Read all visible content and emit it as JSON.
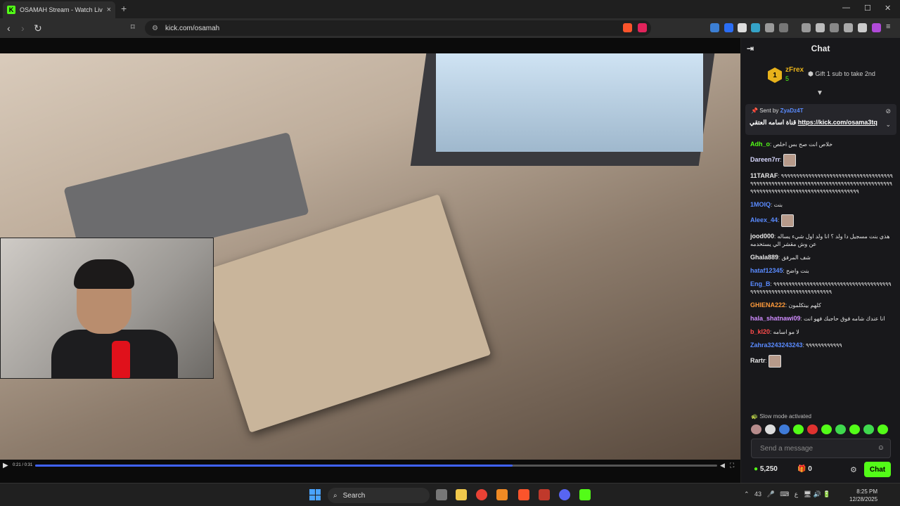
{
  "browser": {
    "tab_title": "OSAMAH Stream - Watch Live",
    "url": "kick.com/osamah",
    "new_tab": "+",
    "close_tab": "×"
  },
  "player": {
    "time": "0:21 / 0:31",
    "progress": 0.7,
    "play_icon": "play-icon"
  },
  "chat": {
    "title": "Chat",
    "leaderboard": {
      "rank": "1",
      "name": "zFrex",
      "count": "5",
      "gift_text": "Gift 1 sub to take 2nd"
    },
    "pinned": {
      "sent_by": "Sent by",
      "sender": "ZyaDz4T",
      "message": "قناة اسامه العتقي",
      "link": "https://kick.com/osama3tq"
    },
    "messages": [
      {
        "user": "Adh_o",
        "color": "#53fc18",
        "text": "خلاص انت صح بس اخلص"
      },
      {
        "user": "Dareen7rr",
        "color": "#d8d8ff",
        "text": "",
        "emote": true
      },
      {
        "user": "11TARAF",
        "color": "#e8e8e8",
        "text": "٩٩٩٩٩٩٩٩٩٩٩٩٩٩٩٩٩٩٩٩٩٩٩٩٩٩٩٩٩٩٩٩٩٩٩٩٩٩٩٩٩٩٩٩٩٩٩٩٩٩٩٩٩٩٩٩٩٩٩٩٩٩٩٩٩٩٩٩٩٩٩٩٩٩٩٩٩٩٩٩٩٩٩٩٩٩٩٩٩٩٩٩٩٩٩٩٩٩٩٩٩٩٩٩٩٩٩٩٩٩٩٩٩٩٩٩٩٩٩٩"
      },
      {
        "user": "1MOIQ",
        "color": "#5a8bff",
        "text": "بنت"
      },
      {
        "user": "Aleex_44",
        "color": "#5a8bff",
        "text": "",
        "emote": true
      },
      {
        "user": "jood000",
        "color": "#e8e8e8",
        "text": "هذي بنت مسجيل دا ولد ؟ انا ولد اول شيء يساله عن وش مقشر الي يستخدمه"
      },
      {
        "user": "Ghala889",
        "color": "#e8e8e8",
        "text": "شف المرفق"
      },
      {
        "user": "hataf12345",
        "color": "#5a8bff",
        "text": "بنت واضح"
      },
      {
        "user": "Eng_B",
        "color": "#5a8bff",
        "text": "٩٩٩٩٩٩٩٩٩٩٩٩٩٩٩٩٩٩٩٩٩٩٩٩٩٩٩٩٩٩٩٩٩٩٩٩٩٩٩٩٩٩٩٩٩٩٩٩٩٩٩٩٩٩٩٩٩٩٩٩٩٩٩٩٩٩"
      },
      {
        "user": "GHIENA222",
        "color": "#ff9b3b",
        "text": "كلهم بيتكلمون"
      },
      {
        "user": "hala_shatnawi09",
        "color": "#d08cff",
        "text": "انا عندك شامه فوق حاجبك فهو انت"
      },
      {
        "user": "b_kl20",
        "color": "#ff4b4b",
        "text": "لا مو اسامه"
      },
      {
        "user": "Zahra3243243243",
        "color": "#5a8bff",
        "text": "٩٩٩٩٩٩٩٩٩٩٩٩"
      },
      {
        "user": "Rartr",
        "color": "#e8e8e8",
        "text": "",
        "emote": true
      }
    ],
    "slow_mode": "Slow mode activated",
    "input_placeholder": "Send a message",
    "points": "5,250",
    "gifts": "0",
    "chat_button": "Chat"
  },
  "taskbar": {
    "search": "Search",
    "tray_count": "43",
    "time": "8:25 PM",
    "date": "12/28/2025"
  },
  "colors": {
    "kick_green": "#53fc18",
    "progress_blue": "#4063ff"
  }
}
